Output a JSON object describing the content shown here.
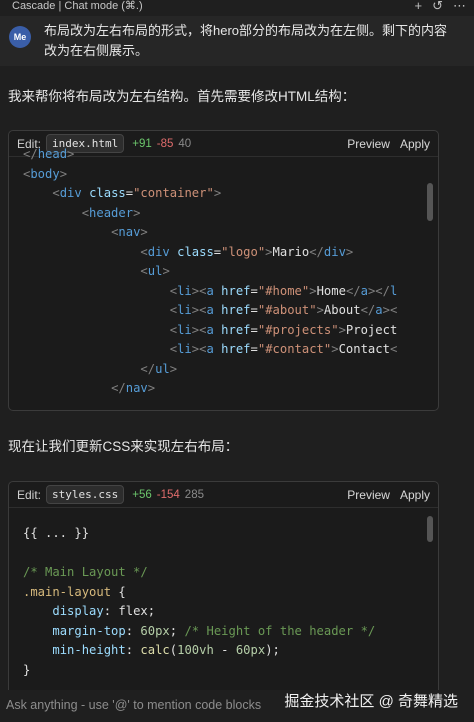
{
  "titlebar": {
    "title": "Cascade | Chat mode (⌘.)",
    "plus": "+",
    "history": "↺",
    "more": "⋯"
  },
  "user": {
    "avatar": "Me",
    "message": "布局改为左右布局的形式，将hero部分的布局改为在左侧。剩下的内容改为在右侧展示。"
  },
  "reply": {
    "intro": "我来帮你将布局改为左右结构。首先需要修改HTML结构：",
    "css_intro": "现在让我们更新CSS来实现左右布局："
  },
  "html_card": {
    "edit_label": "Edit:",
    "filename": "index.html",
    "added": "+91",
    "removed": "-85",
    "total": "40",
    "preview": "Preview",
    "apply": "Apply",
    "scroll_fraction": 0.15
  },
  "css_card": {
    "edit_label": "Edit:",
    "filename": "styles.css",
    "added": "+56",
    "removed": "-154",
    "total": "285",
    "preview": "Preview",
    "apply": "Apply",
    "scroll_fraction": 0.03
  },
  "footer": {
    "placeholder": "Ask anything - use '@' to mention code blocks",
    "watermark": "掘金技术社区 @ 奇舞精选"
  }
}
